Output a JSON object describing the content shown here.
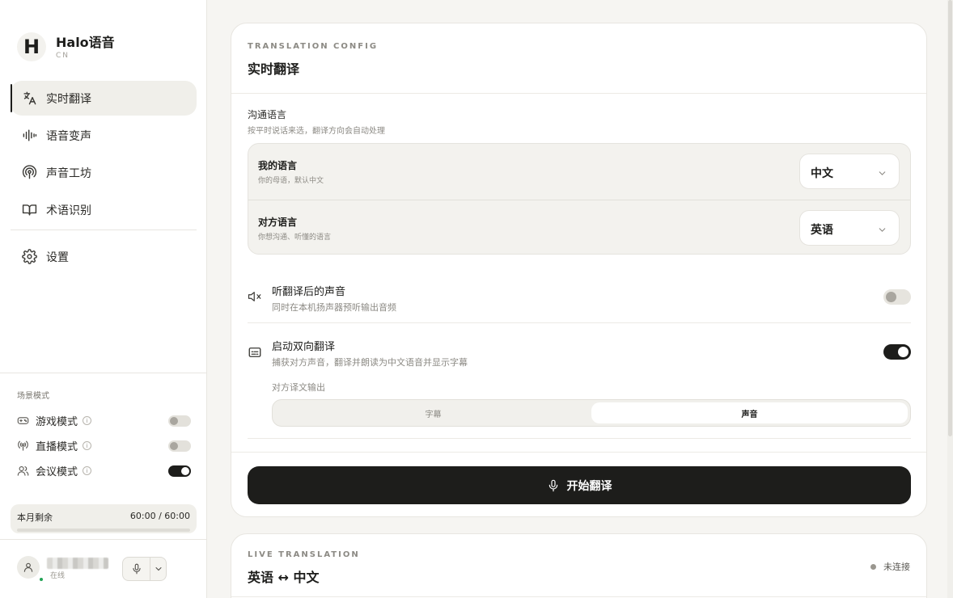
{
  "brand": {
    "logo_letter": "H",
    "name": "Halo语音",
    "sub": "CN"
  },
  "nav": {
    "items": [
      {
        "label": "实时翻译",
        "icon": "translate-icon",
        "active": true
      },
      {
        "label": "语音变声",
        "icon": "waveform-icon",
        "active": false
      },
      {
        "label": "声音工坊",
        "icon": "podcast-icon",
        "active": false
      },
      {
        "label": "术语识别",
        "icon": "book-icon",
        "active": false
      }
    ],
    "settings": {
      "label": "设置",
      "icon": "gear-icon"
    }
  },
  "scene": {
    "title": "场景模式",
    "modes": [
      {
        "label": "游戏模式",
        "icon": "gamepad-icon",
        "on": false
      },
      {
        "label": "直播模式",
        "icon": "broadcast-icon",
        "on": false
      },
      {
        "label": "会议模式",
        "icon": "users-icon",
        "on": true
      }
    ],
    "info_glyph": "i"
  },
  "quota": {
    "label": "本月剩余",
    "value": "60:00 / 60:00",
    "fraction": 1.0
  },
  "user": {
    "status": "在线"
  },
  "config": {
    "eyebrow": "TRANSLATION CONFIG",
    "title": "实时翻译",
    "section_label": "沟通语言",
    "section_hint": "按平时说话来选，翻译方向会自动处理",
    "my_language": {
      "title": "我的语言",
      "hint": "你的母语，默认中文",
      "value": "中文"
    },
    "other_language": {
      "title": "对方语言",
      "hint": "你想沟通、听懂的语言",
      "value": "英语"
    },
    "listen": {
      "title": "听翻译后的声音",
      "hint": "同时在本机扬声器预听输出音频",
      "on": false
    },
    "bidirectional": {
      "title": "启动双向翻译",
      "hint": "捕获对方声音，翻译并朗读为中文语音并显示字幕",
      "on": true
    },
    "output_label": "对方译文输出",
    "output_options": [
      "字幕",
      "声音"
    ],
    "output_selected": "声音",
    "start_button": "开始翻译"
  },
  "live": {
    "eyebrow": "LIVE TRANSLATION",
    "title": "英语 ↔ 中文",
    "status": "未连接"
  },
  "colors": {
    "accent": "#1d1d1b",
    "background": "#f6f5f2",
    "online": "#22a355"
  }
}
